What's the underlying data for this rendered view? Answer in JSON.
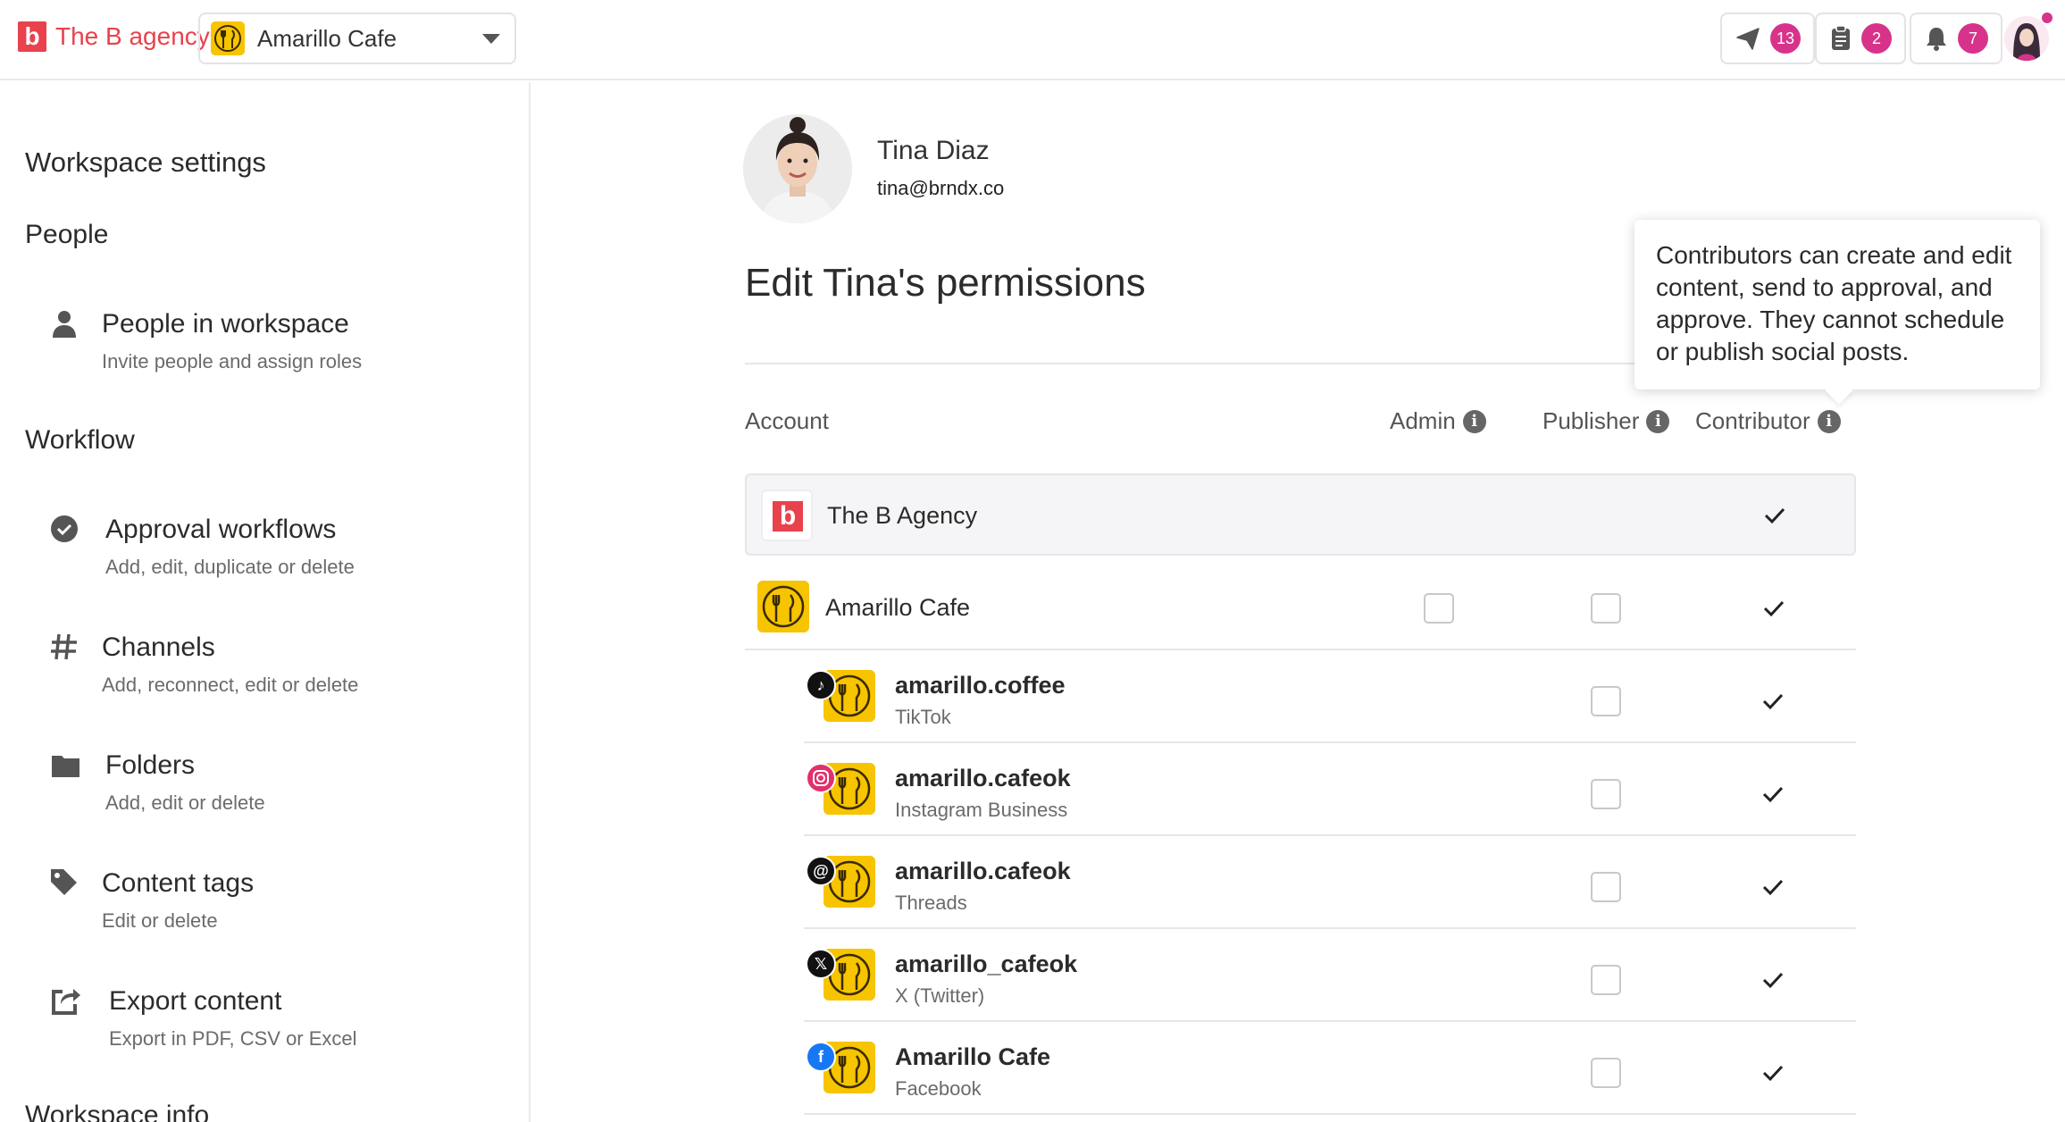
{
  "topbar": {
    "logo_mark": "b",
    "logo_text": "The B agency",
    "workspace": "Amarillo Cafe",
    "send_count": "13",
    "tasks_count": "2",
    "notifications_count": "7"
  },
  "sidebar": {
    "title": "Workspace settings",
    "people_section": "People",
    "workflow_section": "Workflow",
    "info_section": "Workspace info",
    "items": [
      {
        "title": "People in workspace",
        "subtitle": "Invite people and assign roles",
        "icon": "person-icon"
      },
      {
        "title": "Approval workflows",
        "subtitle": "Add, edit, duplicate or delete",
        "icon": "check-circle-icon"
      },
      {
        "title": "Channels",
        "subtitle": "Add, reconnect, edit or delete",
        "icon": "hash-icon"
      },
      {
        "title": "Folders",
        "subtitle": "Add, edit or delete",
        "icon": "folder-icon"
      },
      {
        "title": "Content tags",
        "subtitle": "Edit or delete",
        "icon": "tag-icon"
      },
      {
        "title": "Export content",
        "subtitle": "Export in PDF, CSV or Excel",
        "icon": "export-icon"
      }
    ]
  },
  "profile": {
    "name": "Tina Diaz",
    "email": "tina@brndx.co"
  },
  "page_title": "Edit Tina's permissions",
  "tooltip": "Contributors can create and edit content, send to approval, and approve. They cannot schedule or publish social posts.",
  "table": {
    "columns": {
      "account": "Account",
      "admin": "Admin",
      "publisher": "Publisher",
      "contributor": "Contributor"
    },
    "agency": {
      "name": "The B Agency",
      "logo_mark": "b",
      "contributor": true
    },
    "workspace": {
      "name": "Amarillo Cafe",
      "admin": false,
      "publisher": false,
      "contributor": true
    },
    "accounts": [
      {
        "name": "amarillo.coffee",
        "network": "TikTok",
        "network_icon": "tiktok-icon",
        "badge_color": "#111111",
        "publisher": false,
        "contributor": true
      },
      {
        "name": "amarillo.cafeok",
        "network": "Instagram Business",
        "network_icon": "instagram-icon",
        "badge_color": "#e1306c",
        "publisher": false,
        "contributor": true
      },
      {
        "name": "amarillo.cafeok",
        "network": "Threads",
        "network_icon": "threads-icon",
        "badge_color": "#111111",
        "publisher": false,
        "contributor": true
      },
      {
        "name": "amarillo_cafeok",
        "network": "X (Twitter)",
        "network_icon": "x-icon",
        "badge_color": "#111111",
        "publisher": false,
        "contributor": true
      },
      {
        "name": "Amarillo Cafe",
        "network": "Facebook",
        "network_icon": "facebook-icon",
        "badge_color": "#1877f2",
        "publisher": false,
        "contributor": true
      }
    ]
  },
  "colors": {
    "brand": "#e8424d",
    "badge": "#d8338a",
    "cafe_yellow": "#f7c400"
  }
}
